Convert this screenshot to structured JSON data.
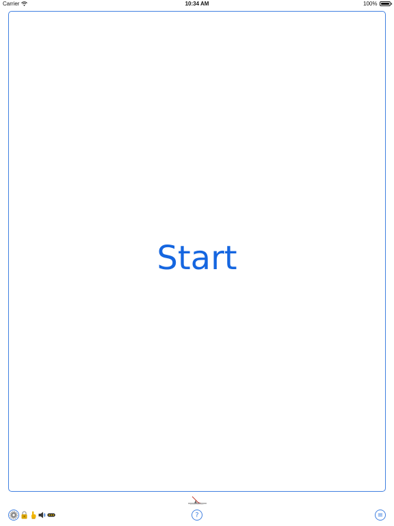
{
  "status_bar": {
    "carrier": "Carrier",
    "time": "10:34 AM",
    "battery": "100%",
    "battery_level": 1.0
  },
  "main": {
    "start_label": "Start"
  },
  "toolbar": {
    "settings_icon": "gear-icon",
    "lock_icon": "lock-icon",
    "touch_icon": "pointing-hand-icon",
    "speaker_icon": "speaker-icon",
    "more_icon": "ellipsis-icon",
    "help_label": "?",
    "menu_label": "≡"
  },
  "colors": {
    "accent": "#3f7fe0",
    "start_text": "#1566e0"
  }
}
